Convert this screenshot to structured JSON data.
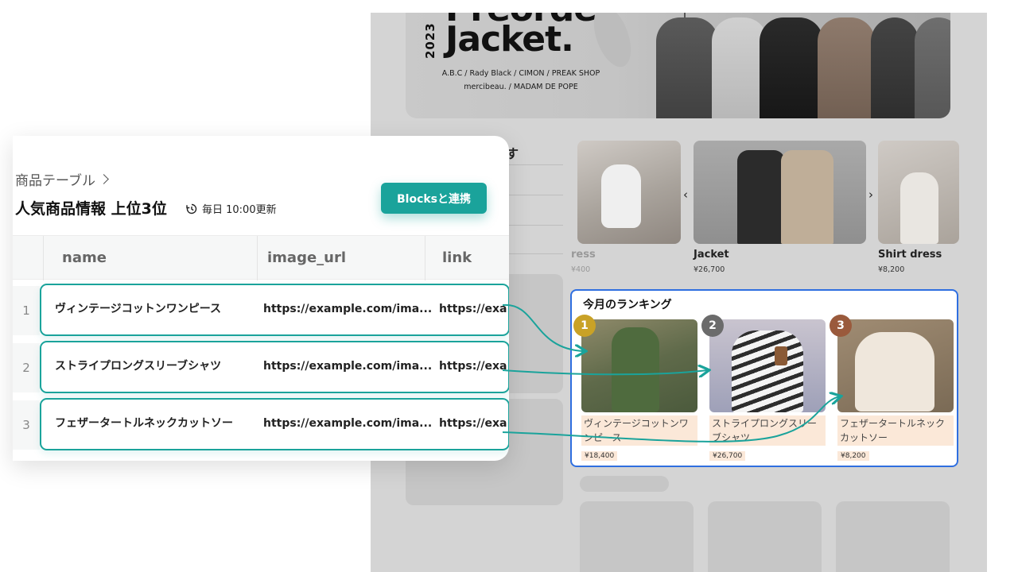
{
  "site": {
    "hero": {
      "year": "2023",
      "title_top": "Preorder",
      "title": "Jacket.",
      "brands_line1": "A.B.C / Rady Black / CIMON / PREAK SHOP",
      "brands_line2": "mercibeau. / MADAM DE POPE"
    },
    "sidebar_heading_fragment": "す",
    "carousel": {
      "items": [
        {
          "label": "ress",
          "price": "¥400"
        },
        {
          "label": "Jacket",
          "price": "¥26,700"
        },
        {
          "label": "Shirt dress",
          "price": "¥8,200"
        }
      ],
      "prev_icon": "chevron-left-icon",
      "next_icon": "chevron-right-icon"
    },
    "ranking": {
      "title": "今月のランキング",
      "items": [
        {
          "rank": "1",
          "name": "ヴィンテージコットンワンピース",
          "price": "¥18,400",
          "badge_color": "#c9a227"
        },
        {
          "rank": "2",
          "name": "ストライプロングスリーブシャツ",
          "price": "¥26,700",
          "badge_color": "#6b6b6b"
        },
        {
          "rank": "3",
          "name": "フェザータートルネックカットソー",
          "price": "¥8,200",
          "badge_color": "#9a5a3c"
        }
      ],
      "border_color": "#2f6fe0"
    }
  },
  "panel": {
    "breadcrumb": "商品テーブル",
    "breadcrumb_icon": "chevron-right-icon",
    "title": "人気商品情報 上位3位",
    "update_icon": "history-icon",
    "update_text": "毎日 10:00更新",
    "blocks_button": "Blocksと連携",
    "accent_color": "#1aa39b",
    "columns": [
      "name",
      "image_url",
      "link"
    ],
    "rows": [
      {
        "index": "1",
        "name": "ヴィンテージコットンワンピース",
        "image_url": "https://example.com/ima...",
        "link": "https://exa"
      },
      {
        "index": "2",
        "name": "ストライプロングスリーブシャツ",
        "image_url": "https://example.com/ima...",
        "link": "https://exa"
      },
      {
        "index": "3",
        "name": "フェザータートルネックカットソー",
        "image_url": "https://example.com/ima...",
        "link": "https://exa"
      }
    ]
  }
}
